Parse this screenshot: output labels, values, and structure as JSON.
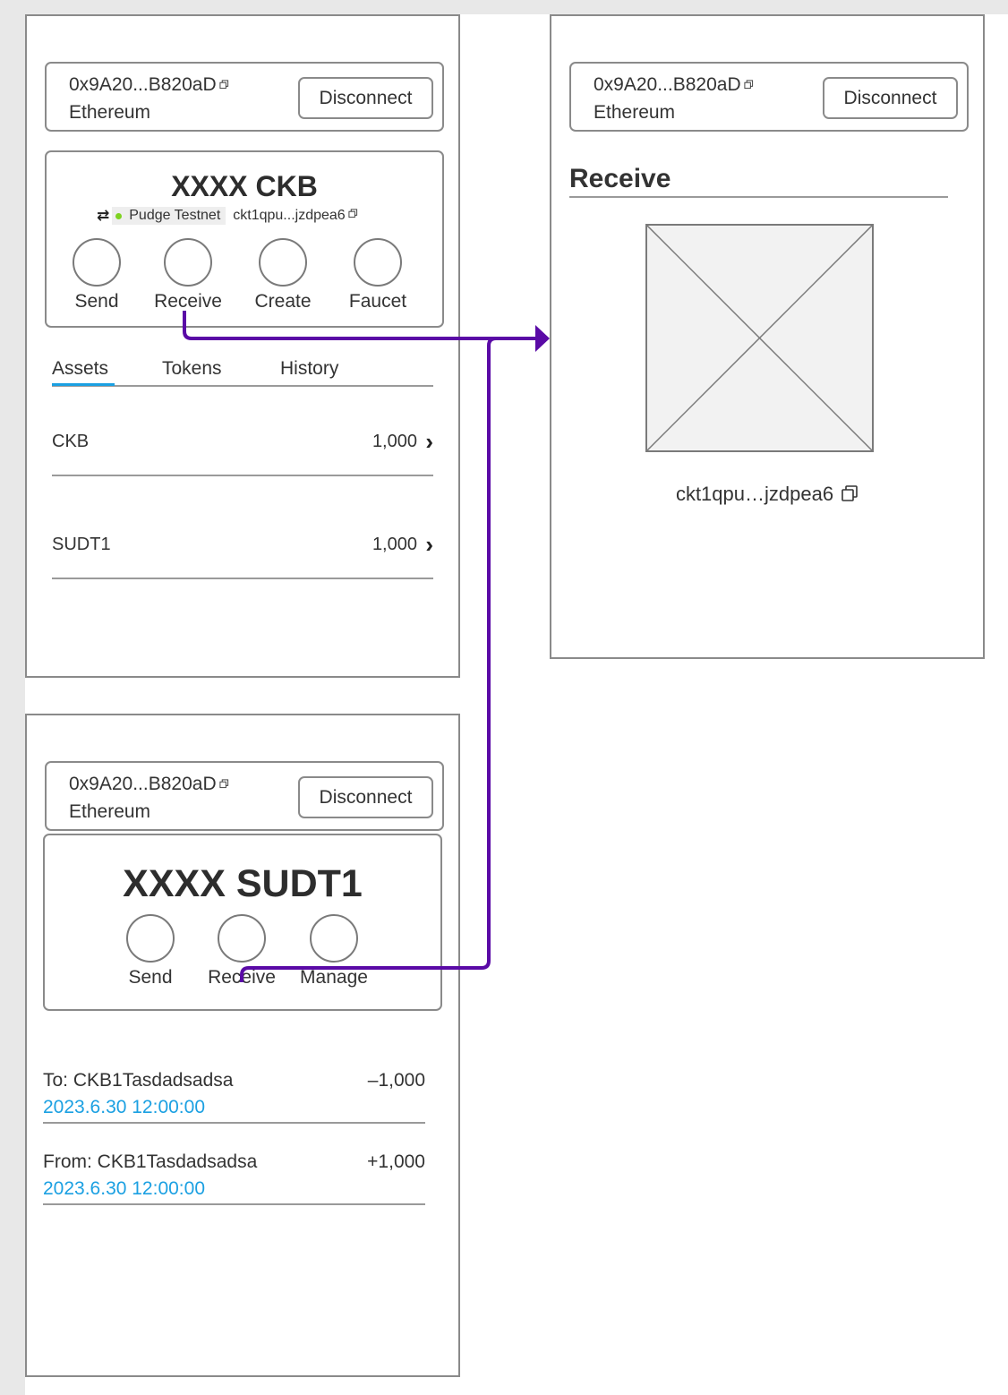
{
  "account": {
    "address": "0x9A20...B820aD",
    "network": "Ethereum",
    "disconnect_label": "Disconnect"
  },
  "wallet": {
    "balance": "XXXX CKB",
    "ckb_network": "Pudge Testnet",
    "ckb_address": "ckt1qpu...jzdpea6",
    "actions": [
      "Send",
      "Receive",
      "Create",
      "Faucet"
    ],
    "tabs": [
      "Assets",
      "Tokens",
      "History"
    ],
    "assets": [
      {
        "name": "CKB",
        "amount": "1,000"
      },
      {
        "name": "SUDT1",
        "amount": "1,000"
      }
    ]
  },
  "receive": {
    "title": "Receive",
    "address": "ckt1qpu…jzdpea6"
  },
  "sudt": {
    "balance": "XXXX SUDT1",
    "actions": [
      "Send",
      "Receive",
      "Manage"
    ],
    "transactions": [
      {
        "who": "To: CKB1Tasdadsadsa",
        "amount": "–1,000",
        "time": "2023.6.30 12:00:00"
      },
      {
        "who": "From: CKB1Tasdadsadsa",
        "amount": "+1,000",
        "time": "2023.6.30 12:00:00"
      }
    ]
  },
  "colors": {
    "flow_arrow": "#5a0aa6",
    "accent": "#1ba0e2",
    "online_dot": "#7ed321",
    "border": "#8a8a8a"
  },
  "icons": [
    "copy-icon",
    "swap-icon",
    "chevron-right-icon",
    "image-placeholder-icon"
  ]
}
